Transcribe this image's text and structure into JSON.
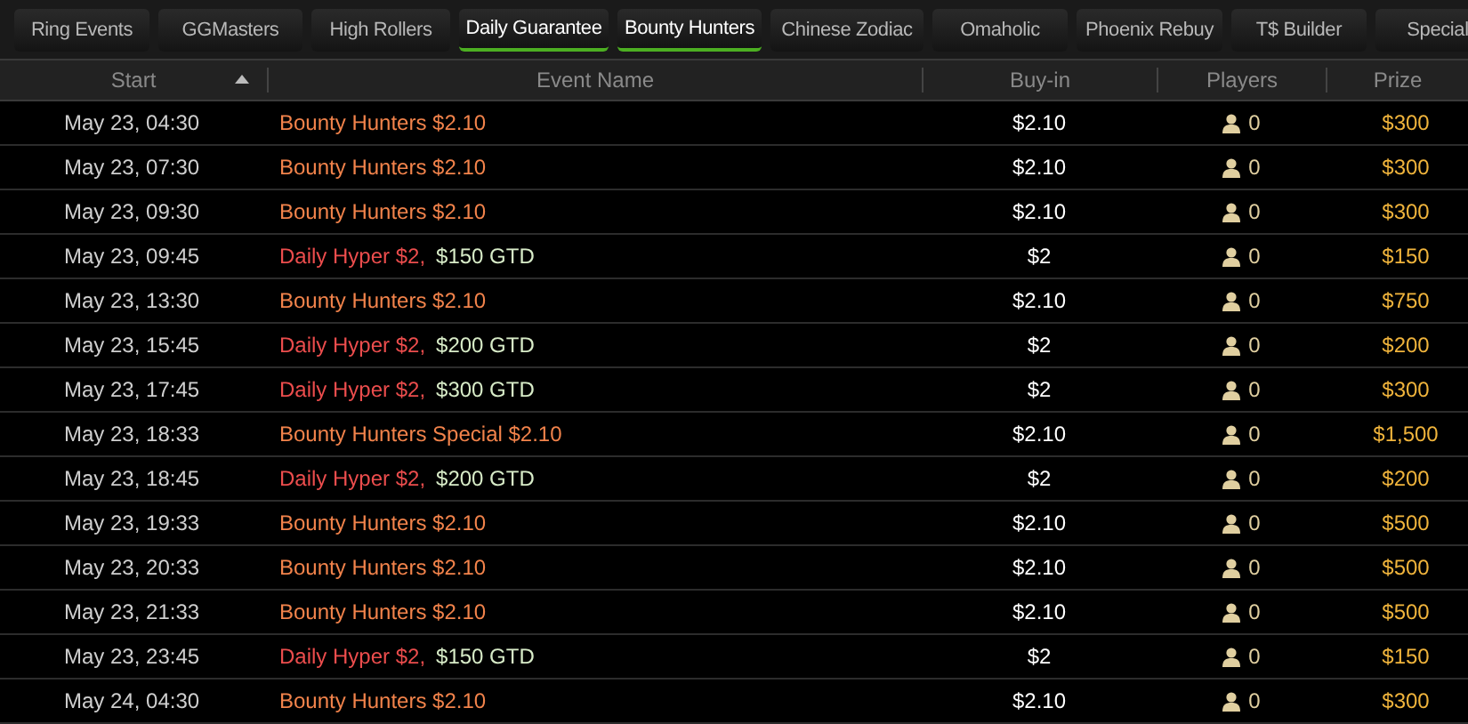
{
  "tabs": [
    {
      "label": "Ring Events",
      "selected": false
    },
    {
      "label": "GGMasters",
      "selected": false
    },
    {
      "label": "High Rollers",
      "selected": false
    },
    {
      "label": "Daily Guarantee",
      "selected": true
    },
    {
      "label": "Bounty Hunters",
      "selected": true
    },
    {
      "label": "Chinese Zodiac",
      "selected": false
    },
    {
      "label": "Omaholic",
      "selected": false
    },
    {
      "label": "Phoenix Rebuy",
      "selected": false
    },
    {
      "label": "T$ Builder",
      "selected": false
    },
    {
      "label": "Special",
      "selected": false
    }
  ],
  "table": {
    "columns": [
      {
        "label": "Start",
        "sorted": true
      },
      {
        "label": "Event Name",
        "sorted": false
      },
      {
        "label": "Buy-in",
        "sorted": false
      },
      {
        "label": "Players",
        "sorted": false
      },
      {
        "label": "Prize",
        "sorted": false
      }
    ],
    "rows": [
      {
        "start": "May 23, 04:30",
        "kind": "bounty",
        "event": "Bounty Hunters $2.10",
        "buy_in": "$2.10",
        "players": "0",
        "prize": "$300"
      },
      {
        "start": "May 23, 07:30",
        "kind": "bounty",
        "event": "Bounty Hunters $2.10",
        "buy_in": "$2.10",
        "players": "0",
        "prize": "$300"
      },
      {
        "start": "May 23, 09:30",
        "kind": "bounty",
        "event": "Bounty Hunters $2.10",
        "buy_in": "$2.10",
        "players": "0",
        "prize": "$300"
      },
      {
        "start": "May 23, 09:45",
        "kind": "hyper",
        "event": "Daily Hyper $2,",
        "guarantee": "$150 GTD",
        "buy_in": "$2",
        "players": "0",
        "prize": "$150"
      },
      {
        "start": "May 23, 13:30",
        "kind": "bounty",
        "event": "Bounty Hunters $2.10",
        "buy_in": "$2.10",
        "players": "0",
        "prize": "$750"
      },
      {
        "start": "May 23, 15:45",
        "kind": "hyper",
        "event": "Daily Hyper $2,",
        "guarantee": "$200 GTD",
        "buy_in": "$2",
        "players": "0",
        "prize": "$200"
      },
      {
        "start": "May 23, 17:45",
        "kind": "hyper",
        "event": "Daily Hyper $2,",
        "guarantee": "$300 GTD",
        "buy_in": "$2",
        "players": "0",
        "prize": "$300"
      },
      {
        "start": "May 23, 18:33",
        "kind": "bounty",
        "event": "Bounty Hunters Special $2.10",
        "buy_in": "$2.10",
        "players": "0",
        "prize": "$1,500"
      },
      {
        "start": "May 23, 18:45",
        "kind": "hyper",
        "event": "Daily Hyper $2,",
        "guarantee": "$200 GTD",
        "buy_in": "$2",
        "players": "0",
        "prize": "$200"
      },
      {
        "start": "May 23, 19:33",
        "kind": "bounty",
        "event": "Bounty Hunters $2.10",
        "buy_in": "$2.10",
        "players": "0",
        "prize": "$500"
      },
      {
        "start": "May 23, 20:33",
        "kind": "bounty",
        "event": "Bounty Hunters $2.10",
        "buy_in": "$2.10",
        "players": "0",
        "prize": "$500"
      },
      {
        "start": "May 23, 21:33",
        "kind": "bounty",
        "event": "Bounty Hunters $2.10",
        "buy_in": "$2.10",
        "players": "0",
        "prize": "$500"
      },
      {
        "start": "May 23, 23:45",
        "kind": "hyper",
        "event": "Daily Hyper $2,",
        "guarantee": "$150 GTD",
        "buy_in": "$2",
        "players": "0",
        "prize": "$150"
      },
      {
        "start": "May 24, 04:30",
        "kind": "bounty",
        "event": "Bounty Hunters $2.10",
        "buy_in": "$2.10",
        "players": "0",
        "prize": "$300"
      }
    ]
  }
}
